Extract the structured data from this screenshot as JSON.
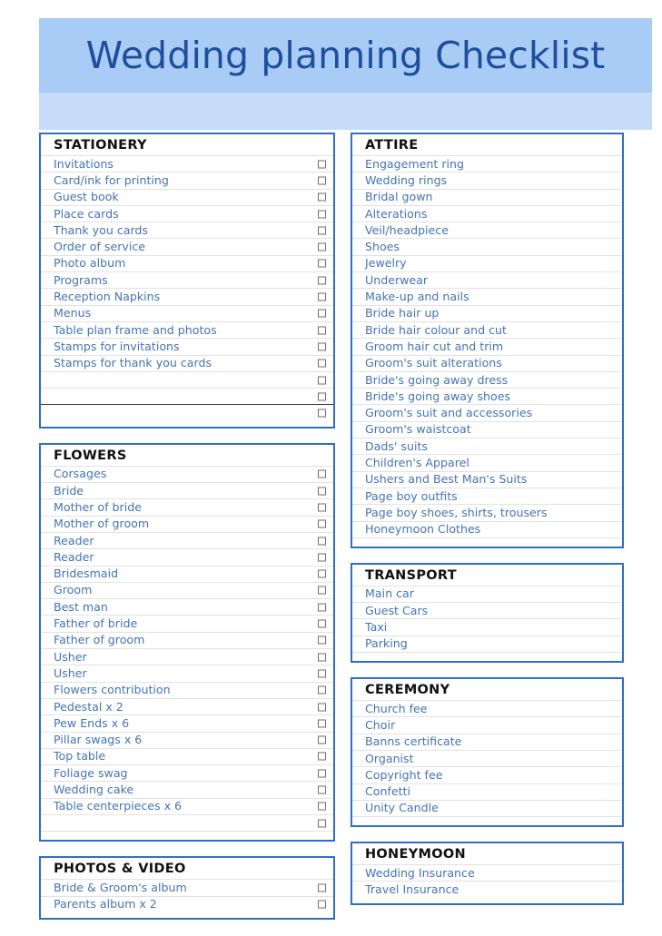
{
  "banner": {
    "title": "Wedding planning Checklist",
    "dark_color": "#a8ccf5",
    "light_color": "#c6dcf8",
    "title_color": "#1f4e9c"
  },
  "theme": {
    "section_border": "#2e6fc4",
    "item_text": "#4474b4",
    "header_text": "#111111",
    "rule": "#e2e2e2",
    "checkbox_border": "#6f6f6f"
  },
  "left_column": [
    {
      "title": "STATIONERY",
      "checkboxes": true,
      "items": [
        "Invitations",
        "Card/ink for printing",
        "Guest book",
        "Place cards",
        "Thank you cards",
        "Order of service",
        "Photo album",
        "Programs",
        "Reception Napkins",
        "Menus",
        "Table plan frame and photos",
        "Stamps for invitations",
        "Stamps for thank you cards",
        "",
        "",
        ""
      ],
      "dark_rule_index": 15,
      "tail": "none"
    },
    {
      "title": "FLOWERS",
      "checkboxes": true,
      "items": [
        "Corsages",
        "Bride",
        "Mother of bride",
        "Mother of groom",
        "Reader",
        "Reader",
        "Bridesmaid",
        "Groom",
        "Best man",
        "Father of bride",
        "Father of groom",
        "Usher",
        "Usher",
        "Flowers contribution",
        "Pedestal x 2",
        "Pew Ends x 6",
        "Pillar swags x 6",
        "Top table",
        "Foliage swag",
        "Wedding cake",
        "Table centerpieces x 6",
        ""
      ],
      "dark_rule_index": -1,
      "tail": "rule"
    },
    {
      "title": "PHOTOS & VIDEO",
      "checkboxes": true,
      "items": [
        "Bride & Groom's album",
        "Parents album x 2"
      ],
      "dark_rule_index": -1,
      "tail": "none"
    }
  ],
  "right_column": [
    {
      "title": "ATTIRE",
      "checkboxes": false,
      "items": [
        "Engagement ring",
        "Wedding rings",
        "Bridal gown",
        "Alterations",
        "Veil/headpiece",
        "Shoes",
        "Jewelry",
        "Underwear",
        "Make-up and nails",
        "Bride hair up",
        "Bride hair colour and cut",
        "Groom hair cut and trim",
        "Groom's suit alterations",
        "Bride's going away dress",
        "Bride's going away shoes",
        "Groom's suit and accessories",
        "Groom's waistcoat",
        "Dads' suits",
        "Children's Apparel",
        "Ushers and Best Man's Suits",
        "Page boy outfits",
        "Page boy shoes, shirts, trousers",
        "Honeymoon Clothes"
      ],
      "dark_rule_index": -1,
      "tail": "rule"
    },
    {
      "title": "TRANSPORT",
      "checkboxes": false,
      "items": [
        "Main car",
        "Guest Cars",
        "Taxi",
        "Parking"
      ],
      "dark_rule_index": -1,
      "tail": "rule"
    },
    {
      "title": "CEREMONY",
      "checkboxes": false,
      "items": [
        "Church fee",
        "Choir",
        "Banns certificate",
        "Organist",
        "Copyright fee",
        "Confetti",
        "Unity Candle"
      ],
      "dark_rule_index": -1,
      "tail": "rule"
    },
    {
      "title": "HONEYMOON",
      "checkboxes": false,
      "items": [
        "Wedding Insurance",
        "Travel Insurance"
      ],
      "dark_rule_index": -1,
      "tail": "none"
    }
  ]
}
